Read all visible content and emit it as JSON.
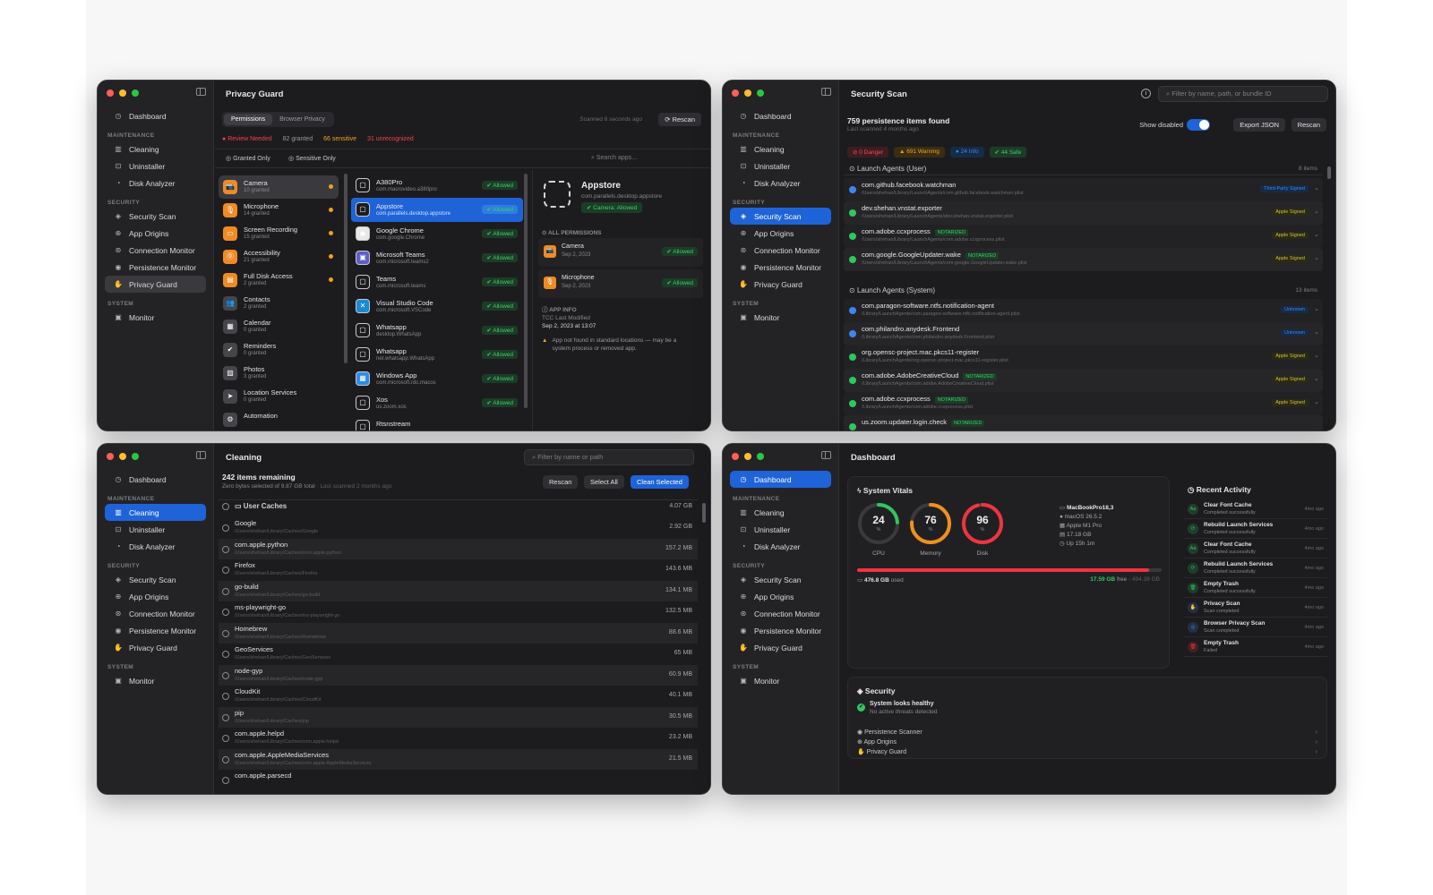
{
  "nav": {
    "dashboard": "Dashboard",
    "sec_maintenance": "MAINTENANCE",
    "cleaning": "Cleaning",
    "uninstaller": "Uninstaller",
    "disk_analyzer": "Disk Analyzer",
    "sec_security": "SECURITY",
    "security_scan": "Security Scan",
    "app_origins": "App Origins",
    "connection_monitor": "Connection Monitor",
    "persistence_monitor": "Persistence Monitor",
    "privacy_guard": "Privacy Guard",
    "sec_system": "SYSTEM",
    "monitor": "Monitor"
  },
  "privacy": {
    "title": "Privacy Guard",
    "tab_permissions": "Permissions",
    "tab_browser": "Browser Privacy",
    "scanned": "Scanned 6 seconds ago",
    "rescan": "Rescan",
    "stat_review": "Review Needed",
    "stat_granted": "82 granted",
    "stat_sensitive": "66 sensitive",
    "stat_unrecognized": "31 unrecognized",
    "filter_granted": "Granted Only",
    "filter_sensitive": "Sensitive Only",
    "search_placeholder": "Search apps...",
    "categories": [
      {
        "name": "Camera",
        "count": "10 granted"
      },
      {
        "name": "Microphone",
        "count": "14 granted"
      },
      {
        "name": "Screen Recording",
        "count": "15 granted"
      },
      {
        "name": "Accessibility",
        "count": "21 granted"
      },
      {
        "name": "Full Disk Access",
        "count": "2 granted"
      },
      {
        "name": "Contacts",
        "count": "2 granted"
      },
      {
        "name": "Calendar",
        "count": "0 granted"
      },
      {
        "name": "Reminders",
        "count": "0 granted"
      },
      {
        "name": "Photos",
        "count": "3 granted"
      },
      {
        "name": "Location Services",
        "count": "0 granted"
      },
      {
        "name": "Automation",
        "count": ""
      }
    ],
    "apps": [
      {
        "name": "A380Pro",
        "id": "com.macrovideo.a380pro",
        "status": "Allowed"
      },
      {
        "name": "Appstore",
        "id": "com.parallels.desktop.appstore",
        "status": "Allowed"
      },
      {
        "name": "Google Chrome",
        "id": "com.google.Chrome",
        "status": "Allowed"
      },
      {
        "name": "Microsoft Teams",
        "id": "com.microsoft.teams2",
        "status": "Allowed"
      },
      {
        "name": "Teams",
        "id": "com.microsoft.teams",
        "status": "Allowed"
      },
      {
        "name": "Visual Studio Code",
        "id": "com.microsoft.VSCode",
        "status": "Allowed"
      },
      {
        "name": "Whatsapp",
        "id": "desktop.WhatsApp",
        "status": "Allowed"
      },
      {
        "name": "Whatsapp",
        "id": "net.whatsapp.WhatsApp",
        "status": "Allowed"
      },
      {
        "name": "Windows App",
        "id": "com.microsoft.rdc.macos",
        "status": "Allowed"
      },
      {
        "name": "Xos",
        "id": "us.zoom.xos",
        "status": "Allowed"
      },
      {
        "name": "Rtsnstream",
        "id": "",
        "status": ""
      }
    ],
    "detail": {
      "name": "Appstore",
      "id": "com.parallels.desktop.appstore",
      "badge": "Camera: Allowed",
      "all_perms": "ALL PERMISSIONS",
      "perms": [
        {
          "name": "Camera",
          "date": "Sep 2, 2023",
          "status": "Allowed"
        },
        {
          "name": "Microphone",
          "date": "Sep 2, 2023",
          "status": "Allowed"
        }
      ],
      "app_info": "APP INFO",
      "tcc_label": "TCC Last Modified",
      "tcc_date": "Sep 2, 2023 at 13:07",
      "warning": "App not found in standard locations — may be a system process or removed app."
    }
  },
  "security": {
    "title": "Security Scan",
    "search_placeholder": "Filter by name, path, or bundle ID",
    "found": "759 persistence items found",
    "last": "Last scanned 4 months ago",
    "show_disabled": "Show disabled",
    "export": "Export JSON",
    "rescan": "Rescan",
    "chips": {
      "danger": "0 Danger",
      "warning": "691 Warning",
      "info": "24 Info",
      "safe": "44 Safe"
    },
    "group_user": "Launch Agents (User)",
    "group_user_count": "8 items",
    "group_system": "Launch Agents (System)",
    "group_system_count": "13 items",
    "user_items": [
      {
        "name": "com.github.facebook.watchman",
        "path": "/Users/shehan/Library/LaunchAgents/com.github.facebook.watchman.plist",
        "tag": "",
        "sign": "Third-Party Signed"
      },
      {
        "name": "dev.shehan.vnstat.exporter",
        "path": "/Users/shehan/Library/LaunchAgents/dev.shehan.vnstat.exporter.plist",
        "tag": "",
        "sign": "Apple Signed"
      },
      {
        "name": "com.adobe.ccxprocess",
        "path": "/Users/shehan/Library/LaunchAgents/com.adobe.ccxprocess.plist",
        "tag": "NOTARIZED",
        "sign": "Apple Signed"
      },
      {
        "name": "com.google.GoogleUpdater.wake",
        "path": "/Users/shehan/Library/LaunchAgents/com.google.GoogleUpdater.wake.plist",
        "tag": "NOTARIZED",
        "sign": "Apple Signed"
      }
    ],
    "system_items": [
      {
        "name": "com.paragon-software.ntfs.notification-agent",
        "path": "/Library/LaunchAgents/com.paragon-software.ntfs.notification-agent.plist",
        "tag": "",
        "sign": "Unknown"
      },
      {
        "name": "com.philandro.anydesk.Frontend",
        "path": "/Library/LaunchAgents/com.philandro.anydesk.Frontend.plist",
        "tag": "",
        "sign": "Unknown"
      },
      {
        "name": "org.opensc-project.mac.pkcs11-register",
        "path": "/Library/LaunchAgents/org.opensc-project.mac.pkcs11-register.plist",
        "tag": "",
        "sign": "Apple Signed"
      },
      {
        "name": "com.adobe.AdobeCreativeCloud",
        "path": "/Library/LaunchAgents/com.adobe.AdobeCreativeCloud.plist",
        "tag": "NOTARIZED",
        "sign": "Apple Signed"
      },
      {
        "name": "com.adobe.ccxprocess",
        "path": "/Library/LaunchAgents/com.adobe.ccxprocess.plist",
        "tag": "NOTARIZED",
        "sign": "Apple Signed"
      },
      {
        "name": "us.zoom.updater.login.check",
        "path": "",
        "tag": "NOTARIZED",
        "sign": ""
      }
    ]
  },
  "cleaning": {
    "title": "Cleaning",
    "search_placeholder": "Filter by name or path",
    "remaining": "242 items remaining",
    "selected": "Zero bytes selected of 9.87 GB total",
    "last": "Last scanned 2 months ago",
    "rescan": "Rescan",
    "select_all": "Select All",
    "clean_selected": "Clean Selected",
    "group": "User Caches",
    "group_size": "4.07 GB",
    "items": [
      {
        "name": "Google",
        "path": "/Users/shehan/Library/Caches/Google",
        "size": "2.92 GB"
      },
      {
        "name": "com.apple.python",
        "path": "/Users/shehan/Library/Caches/com.apple.python",
        "size": "157.2 MB"
      },
      {
        "name": "Firefox",
        "path": "/Users/shehan/Library/Caches/Firefox",
        "size": "143.6 MB"
      },
      {
        "name": "go-build",
        "path": "/Users/shehan/Library/Caches/go-build",
        "size": "134.1 MB"
      },
      {
        "name": "ms-playwright-go",
        "path": "/Users/shehan/Library/Caches/ms-playwright-go",
        "size": "132.5 MB"
      },
      {
        "name": "Homebrew",
        "path": "/Users/shehan/Library/Caches/Homebrew",
        "size": "88.6 MB"
      },
      {
        "name": "GeoServices",
        "path": "/Users/shehan/Library/Caches/GeoServices",
        "size": "65 MB"
      },
      {
        "name": "node-gyp",
        "path": "/Users/shehan/Library/Caches/node-gyp",
        "size": "60.9 MB"
      },
      {
        "name": "CloudKit",
        "path": "/Users/shehan/Library/Caches/CloudKit",
        "size": "40.1 MB"
      },
      {
        "name": "pip",
        "path": "/Users/shehan/Library/Caches/pip",
        "size": "30.5 MB"
      },
      {
        "name": "com.apple.helpd",
        "path": "/Users/shehan/Library/Caches/com.apple.helpd",
        "size": "23.2 MB"
      },
      {
        "name": "com.apple.AppleMediaServices",
        "path": "/Users/shehan/Library/Caches/com.apple.AppleMediaServices",
        "size": "21.5 MB"
      },
      {
        "name": "com.apple.parsecd",
        "path": "",
        "size": ""
      }
    ]
  },
  "dashboard": {
    "title": "Dashboard",
    "vitals": "System Vitals",
    "gauges": [
      {
        "value": "24",
        "unit": "%",
        "label": "CPU",
        "fraction": 0.24,
        "color": "#30c75e"
      },
      {
        "value": "76",
        "unit": "%",
        "label": "Memory",
        "fraction": 0.76,
        "color": "#f0901e"
      },
      {
        "value": "96",
        "unit": "%",
        "label": "Disk",
        "fraction": 0.96,
        "color": "#f0343e"
      }
    ],
    "device": {
      "model": "MacBookPro18,3",
      "os": "macOS 26.5.2",
      "chip": "Apple M1 Pro",
      "memory": "17.18 GB",
      "uptime": "Up 15h 1m"
    },
    "disk": {
      "used": "476.8 GB",
      "used_label": "used",
      "free": "17.59 GB",
      "free_label": "free",
      "total": "494.38 GB",
      "fraction": 0.96
    },
    "recent_title": "Recent Activity",
    "recent": [
      {
        "title": "Clear Font Cache",
        "status": "Completed successfully",
        "time": "4mo ago",
        "color": "#30c75e",
        "glyph": "Aa"
      },
      {
        "title": "Rebuild Launch Services",
        "status": "Completed successfully",
        "time": "4mo ago",
        "color": "#30c75e",
        "glyph": "⟳"
      },
      {
        "title": "Clear Font Cache",
        "status": "Completed successfully",
        "time": "4mo ago",
        "color": "#30c75e",
        "glyph": "Aa"
      },
      {
        "title": "Rebuild Launch Services",
        "status": "Completed successfully",
        "time": "4mo ago",
        "color": "#30c75e",
        "glyph": "⟳"
      },
      {
        "title": "Empty Trash",
        "status": "Completed successfully",
        "time": "4mo ago",
        "color": "#30c75e",
        "glyph": "🗑"
      },
      {
        "title": "Privacy Scan",
        "status": "Scan completed",
        "time": "4mo ago",
        "color": "#3d86f0",
        "glyph": "✋"
      },
      {
        "title": "Browser Privacy Scan",
        "status": "Scan completed",
        "time": "4mo ago",
        "color": "#3d86f0",
        "glyph": "◎"
      },
      {
        "title": "Empty Trash",
        "status": "Failed",
        "time": "4mo ago",
        "color": "#f0343e",
        "glyph": "🗑"
      }
    ],
    "security_title": "Security",
    "healthy": "System looks healthy",
    "no_threats": "No active threats detected",
    "links": [
      "Persistence Scanner",
      "App Origins",
      "Privacy Guard"
    ]
  }
}
